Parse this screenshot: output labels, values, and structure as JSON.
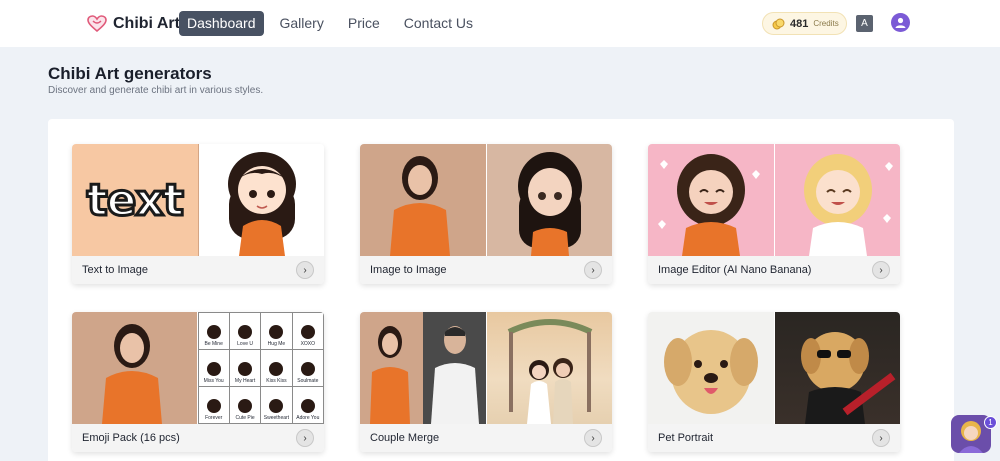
{
  "nav": {
    "brand": "Chibi Art",
    "brand_icon": "heart-logo-icon",
    "links": [
      {
        "label": "Dashboard",
        "active": true
      },
      {
        "label": "Gallery",
        "active": false
      },
      {
        "label": "Price",
        "active": false
      },
      {
        "label": "Contact Us",
        "active": false
      }
    ],
    "credits": {
      "value": "481",
      "label": "Credits"
    },
    "lang_icon": "translate-icon",
    "avatar_icon": "user-avatar-icon"
  },
  "header": {
    "title": "Chibi Art generators",
    "subtitle": "Discover and generate chibi art in various styles."
  },
  "cards": [
    {
      "label": "Text to Image",
      "arrow": "›",
      "image_text": "text"
    },
    {
      "label": "Image to Image",
      "arrow": "›"
    },
    {
      "label": "Image Editor  (AI Nano Banana)",
      "arrow": "›"
    },
    {
      "label": "Emoji Pack (16 pcs)",
      "arrow": "›",
      "stickers": [
        "Be Mine",
        "Love U",
        "Hug Me",
        "XOXO",
        "Miss You",
        "My Heart",
        "Kiss Kiss",
        "Soulmate",
        "Forever",
        "Cute Pie",
        "Sweetheart",
        "Adore You"
      ]
    },
    {
      "label": "Couple Merge",
      "arrow": "›"
    },
    {
      "label": "Pet Portrait",
      "arrow": "›"
    }
  ],
  "float": {
    "badge": "1"
  },
  "colors": {
    "accent": "#485263",
    "brand": "#e05a7a",
    "avatar": "#7b5ad6"
  }
}
